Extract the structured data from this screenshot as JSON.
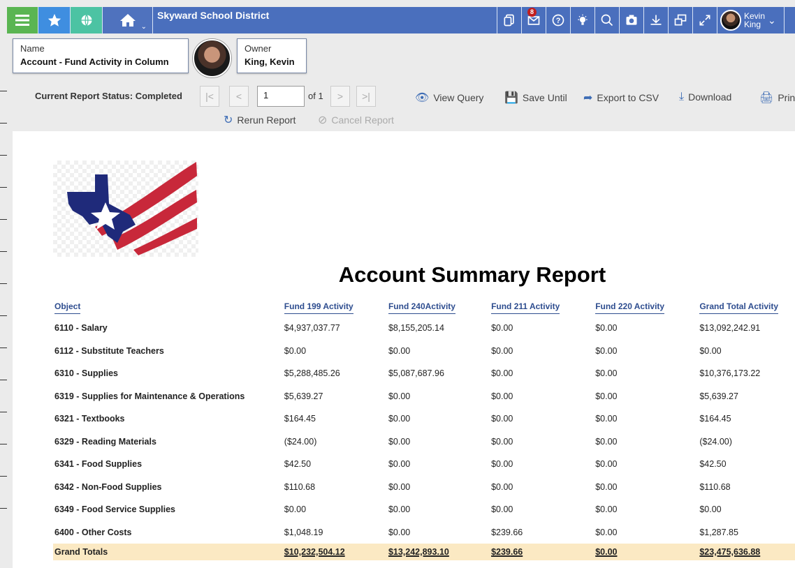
{
  "app": {
    "title": "Skyward School District",
    "mail_badge": "8",
    "user_first": "Kevin",
    "user_last": "King"
  },
  "header": {
    "name_label": "Name",
    "name_value": "Account - Fund Activity in Column",
    "owner_label": "Owner",
    "owner_value": "King, Kevin"
  },
  "toolbar": {
    "status": "Current Report Status: Completed",
    "page_value": "1",
    "page_of": "of 1",
    "view_query": "View Query",
    "save_until": "Save Until",
    "export_csv": "Export to CSV",
    "download": "Download",
    "print": "Print",
    "rerun": "Rerun Report",
    "cancel": "Cancel Report"
  },
  "report": {
    "title": "Account Summary Report",
    "columns": [
      "Object",
      "Fund 199 Activity",
      "Fund 240Activity",
      "Fund 211 Activity",
      "Fund 220 Activity",
      "Grand Total Activity"
    ],
    "rows": [
      [
        "6110 - Salary",
        "$4,937,037.77",
        "$8,155,205.14",
        "$0.00",
        "$0.00",
        "$13,092,242.91"
      ],
      [
        "6112 - Substitute Teachers",
        "$0.00",
        "$0.00",
        "$0.00",
        "$0.00",
        "$0.00"
      ],
      [
        "6310 - Supplies",
        "$5,288,485.26",
        "$5,087,687.96",
        "$0.00",
        "$0.00",
        "$10,376,173.22"
      ],
      [
        "6319 - Supplies for Maintenance & Operations",
        "$5,639.27",
        "$0.00",
        "$0.00",
        "$0.00",
        "$5,639.27"
      ],
      [
        "6321 - Textbooks",
        "$164.45",
        "$0.00",
        "$0.00",
        "$0.00",
        "$164.45"
      ],
      [
        "6329 - Reading Materials",
        "($24.00)",
        "$0.00",
        "$0.00",
        "$0.00",
        "($24.00)"
      ],
      [
        "6341 - Food Supplies",
        "$42.50",
        "$0.00",
        "$0.00",
        "$0.00",
        "$42.50"
      ],
      [
        "6342 - Non-Food Supplies",
        "$110.68",
        "$0.00",
        "$0.00",
        "$0.00",
        "$110.68"
      ],
      [
        "6349 - Food Service Supplies",
        "$0.00",
        "$0.00",
        "$0.00",
        "$0.00",
        "$0.00"
      ],
      [
        "6400 - Other Costs",
        "$1,048.19",
        "$0.00",
        "$239.66",
        "$0.00",
        "$1,287.85"
      ]
    ],
    "totals": [
      "Grand Totals",
      "$10,232,504.12",
      "$13,242,893.10",
      "$239.66",
      "$0.00",
      "$23,475,636.88"
    ]
  },
  "icons": {
    "menu": "hamburger-icon",
    "favorites": "star-icon",
    "web": "globe-icon",
    "home": "home-icon",
    "copy": "copy-icon",
    "mail": "mail-icon",
    "help": "help-icon",
    "tips": "lightbulb-icon",
    "search": "search-icon",
    "screenshot": "camera-icon",
    "download": "download-icon",
    "windows": "windows-icon",
    "expand": "expand-icon"
  },
  "colors": {
    "topbar": "#4a6fbd",
    "menu_green": "#5ab552",
    "star_blue": "#3f8ee0",
    "globe_teal": "#4cc3a3",
    "header_text": "#2e4d8f",
    "total_row": "#fbe9c3",
    "badge": "#c21f1f"
  }
}
